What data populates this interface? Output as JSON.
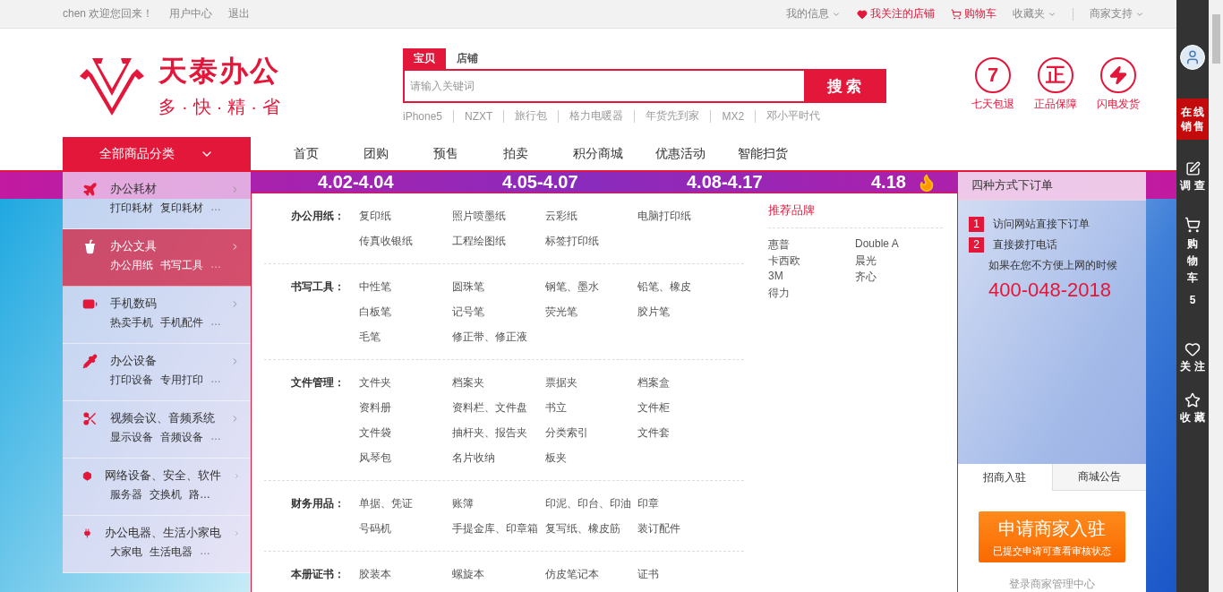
{
  "top_bar": {
    "user": "chen",
    "welcome": "欢迎您回来！",
    "links": [
      "用户中心",
      "退出"
    ],
    "right_links": [
      {
        "label": "我的信息",
        "kind": "dropdown"
      },
      {
        "label": "我关注的店铺",
        "kind": "follow"
      },
      {
        "label": "购物车",
        "kind": "cart"
      },
      {
        "label": "收藏夹",
        "kind": "dropdown"
      },
      {
        "label": "商家支持",
        "kind": "dropdown"
      }
    ]
  },
  "logo": {
    "name": "天泰办公",
    "slogan": "多·快·精·省"
  },
  "search": {
    "tabs": [
      {
        "label": "宝贝",
        "selected": true
      },
      {
        "label": "店铺",
        "selected": false
      }
    ],
    "placeholder": "请输入关键词",
    "button": "搜 索",
    "hot_words": [
      "iPhone5",
      "NZXT",
      "旅行包",
      "格力电暖器",
      "年货先到家",
      "MX2",
      "邓小平时代"
    ]
  },
  "promises": [
    {
      "mark": "7",
      "kind": "text",
      "label": "七天包退"
    },
    {
      "mark": "正",
      "kind": "text",
      "label": "正品保障"
    },
    {
      "kind": "bolt",
      "label": "闪电发货"
    }
  ],
  "nav": {
    "category_button": "全部商品分类",
    "items": [
      "首页",
      "团购",
      "预售",
      "拍卖",
      "积分商城",
      "优惠活动",
      "智能扫货"
    ]
  },
  "categories": [
    {
      "title": "办公耗材",
      "subs": [
        "打印耗材",
        "复印耗材"
      ],
      "more": "…",
      "selected": false
    },
    {
      "title": "办公文具",
      "subs": [
        "办公用纸",
        "书写工具"
      ],
      "more": "…",
      "selected": true
    },
    {
      "title": "手机数码",
      "subs": [
        "热卖手机",
        "手机配件"
      ],
      "more": "…",
      "selected": false
    },
    {
      "title": "办公设备",
      "subs": [
        "打印设备",
        "专用打印"
      ],
      "more": "…",
      "selected": false
    },
    {
      "title": "视频会议、音频系统",
      "subs": [
        "显示设备",
        "音频设备"
      ],
      "more": "…",
      "selected": false
    },
    {
      "title": "网络设备、安全、软件",
      "subs": [
        "服务器",
        "交换机",
        "路…"
      ],
      "selected": false
    },
    {
      "title": "办公电器、生活小家电",
      "subs": [
        "大家电",
        "生活电器"
      ],
      "more": "…",
      "selected": false
    }
  ],
  "banner": {
    "dates": [
      "4.02-4.04",
      "4.05-4.07",
      "4.08-4.17",
      "4.18"
    ]
  },
  "flyout": {
    "sections": [
      {
        "label": "办公用纸：",
        "items": [
          "复印纸",
          "照片喷墨纸",
          "云彩纸",
          "电脑打印纸",
          "传真收银纸",
          "工程绘图纸",
          "标签打印纸"
        ]
      },
      {
        "label": "书写工具：",
        "items": [
          "中性笔",
          "圆珠笔",
          "钢笔、墨水",
          "铅笔、橡皮",
          "白板笔",
          "记号笔",
          "荧光笔",
          "胶片笔",
          "毛笔",
          "修正带、修正液"
        ]
      },
      {
        "label": "文件管理：",
        "items": [
          "文件夹",
          "档案夹",
          "票据夹",
          "档案盒",
          "资料册",
          "资料栏、文件盘",
          "书立",
          "文件柜",
          "文件袋",
          "抽杆夹、报告夹",
          "分类索引",
          "文件套",
          "风琴包",
          "名片收纳",
          "板夹"
        ]
      },
      {
        "label": "财务用品：",
        "items": [
          "单据、凭证",
          "账簿",
          "印泥、印台、印油",
          "印章",
          "号码机",
          "手提金库、印章箱",
          "复写纸、橡皮筋",
          "装订配件"
        ]
      },
      {
        "label": "本册证书：",
        "items": [
          "胶装本",
          "螺旋本",
          "仿皮笔记本",
          "证书"
        ]
      }
    ],
    "brands_title": "推荐品牌",
    "brands": [
      "惠普",
      "Double A",
      "卡西欧",
      "晨光",
      "3M",
      "齐心",
      "得力"
    ]
  },
  "order_panel": {
    "title": "四种方式下订单",
    "steps": [
      {
        "number": "1",
        "text": "访问网站直接下订单"
      },
      {
        "number": "2",
        "text": "直接拨打电话"
      }
    ],
    "note": "如果在您不方便上网的时候",
    "phone": "400-048-2018",
    "tabs": [
      {
        "label": "招商入驻",
        "selected": true
      },
      {
        "label": "商城公告",
        "selected": false
      }
    ],
    "apply": {
      "title": "申请商家入驻",
      "subtitle": "已提交申请可查看审核状态"
    },
    "login_link": "登录商家管理中心"
  },
  "toolbar": {
    "online": "在线销售",
    "items": [
      {
        "kind": "survey",
        "label": "调 查"
      },
      {
        "kind": "cart",
        "label": "购物车",
        "count": "5"
      },
      {
        "kind": "follow",
        "label": "关 注"
      },
      {
        "kind": "favorite",
        "label": "收 藏"
      }
    ]
  }
}
